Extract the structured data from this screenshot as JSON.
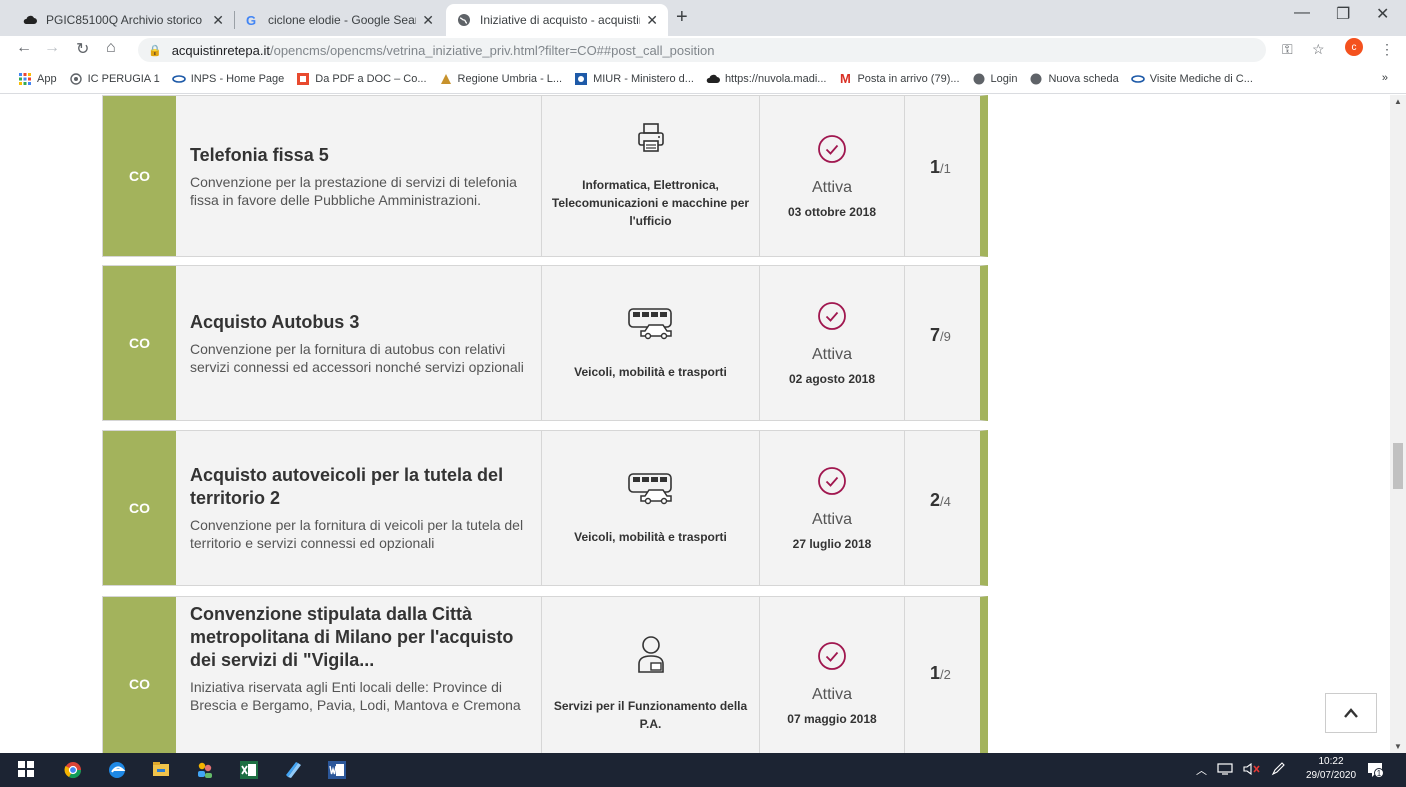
{
  "browser": {
    "tabs": [
      {
        "title": "PGIC85100Q Archivio storico",
        "favicon": "cloud-icon"
      },
      {
        "title": "ciclone elodie - Google Search",
        "favicon": "google-icon"
      },
      {
        "title": "Iniziative di acquisto - acquistinr",
        "favicon": "globe-icon"
      }
    ],
    "url_host": "acquistinretepa.it",
    "url_path": "/opencms/opencms/vetrina_iniziative_priv.html?filter=CO##post_call_position",
    "profile_initial": "c"
  },
  "bookmarks": [
    {
      "label": "App",
      "icon": "apps-grid-icon"
    },
    {
      "label": "IC PERUGIA 1",
      "icon": "school-icon"
    },
    {
      "label": "INPS - Home Page",
      "icon": "inps-icon"
    },
    {
      "label": "Da PDF a DOC – Co...",
      "icon": "pdf-icon"
    },
    {
      "label": "Regione Umbria - L...",
      "icon": "region-icon"
    },
    {
      "label": "MIUR - Ministero d...",
      "icon": "miur-icon"
    },
    {
      "label": "https://nuvola.madi...",
      "icon": "cloud-icon"
    },
    {
      "label": "Posta in arrivo (79)...",
      "icon": "gmail-icon"
    },
    {
      "label": "Login",
      "icon": "globe-icon"
    },
    {
      "label": "Nuova scheda",
      "icon": "globe-icon"
    },
    {
      "label": "Visite Mediche di C...",
      "icon": "inps-icon"
    }
  ],
  "bookmarks_more": "»",
  "cards": [
    {
      "type": "CO",
      "title": "Telefonia fissa 5",
      "description": "Convenzione per la prestazione di servizi di telefonia fissa in favore delle Pubbliche Amministrazioni.",
      "category": "Informatica, Elettronica, Telecomunicazioni e macchine per l'ufficio",
      "category_icon": "printer-icon",
      "status": "Attiva",
      "date": "03 ottobre 2018",
      "count": "1",
      "total": "/1"
    },
    {
      "type": "CO",
      "title": "Acquisto Autobus 3",
      "description": "Convenzione per la fornitura di autobus con relativi servizi connessi ed accessori nonché servizi opzionali",
      "category": "Veicoli, mobilità e trasporti",
      "category_icon": "vehicles-icon",
      "status": "Attiva",
      "date": "02 agosto 2018",
      "count": "7",
      "total": "/9"
    },
    {
      "type": "CO",
      "title": "Acquisto autoveicoli per la tutela del territorio 2",
      "description": "Convenzione per la fornitura di veicoli per la tutela del territorio e servizi connessi ed opzionali",
      "category": "Veicoli, mobilità e trasporti",
      "category_icon": "vehicles-icon",
      "status": "Attiva",
      "date": "27 luglio 2018",
      "count": "2",
      "total": "/4"
    },
    {
      "type": "CO",
      "title": "Convenzione stipulata dalla Città metropolitana di Milano per l'acquisto dei servizi di \"Vigila...",
      "description": "Iniziativa riservata agli Enti locali delle: Province di Brescia e Bergamo, Pavia, Lodi, Mantova e Cremona",
      "category": "Servizi per il Funzionamento della P.A.",
      "category_icon": "person-icon",
      "status": "Attiva",
      "date": "07 maggio 2018",
      "count": "1",
      "total": "/2"
    }
  ],
  "colors": {
    "accent": "#a3b35c",
    "status_icon": "#a0174f",
    "taskbar": "#1c2433"
  },
  "taskbar": {
    "time": "10:22",
    "date": "29/07/2020",
    "notification_count": "1"
  }
}
